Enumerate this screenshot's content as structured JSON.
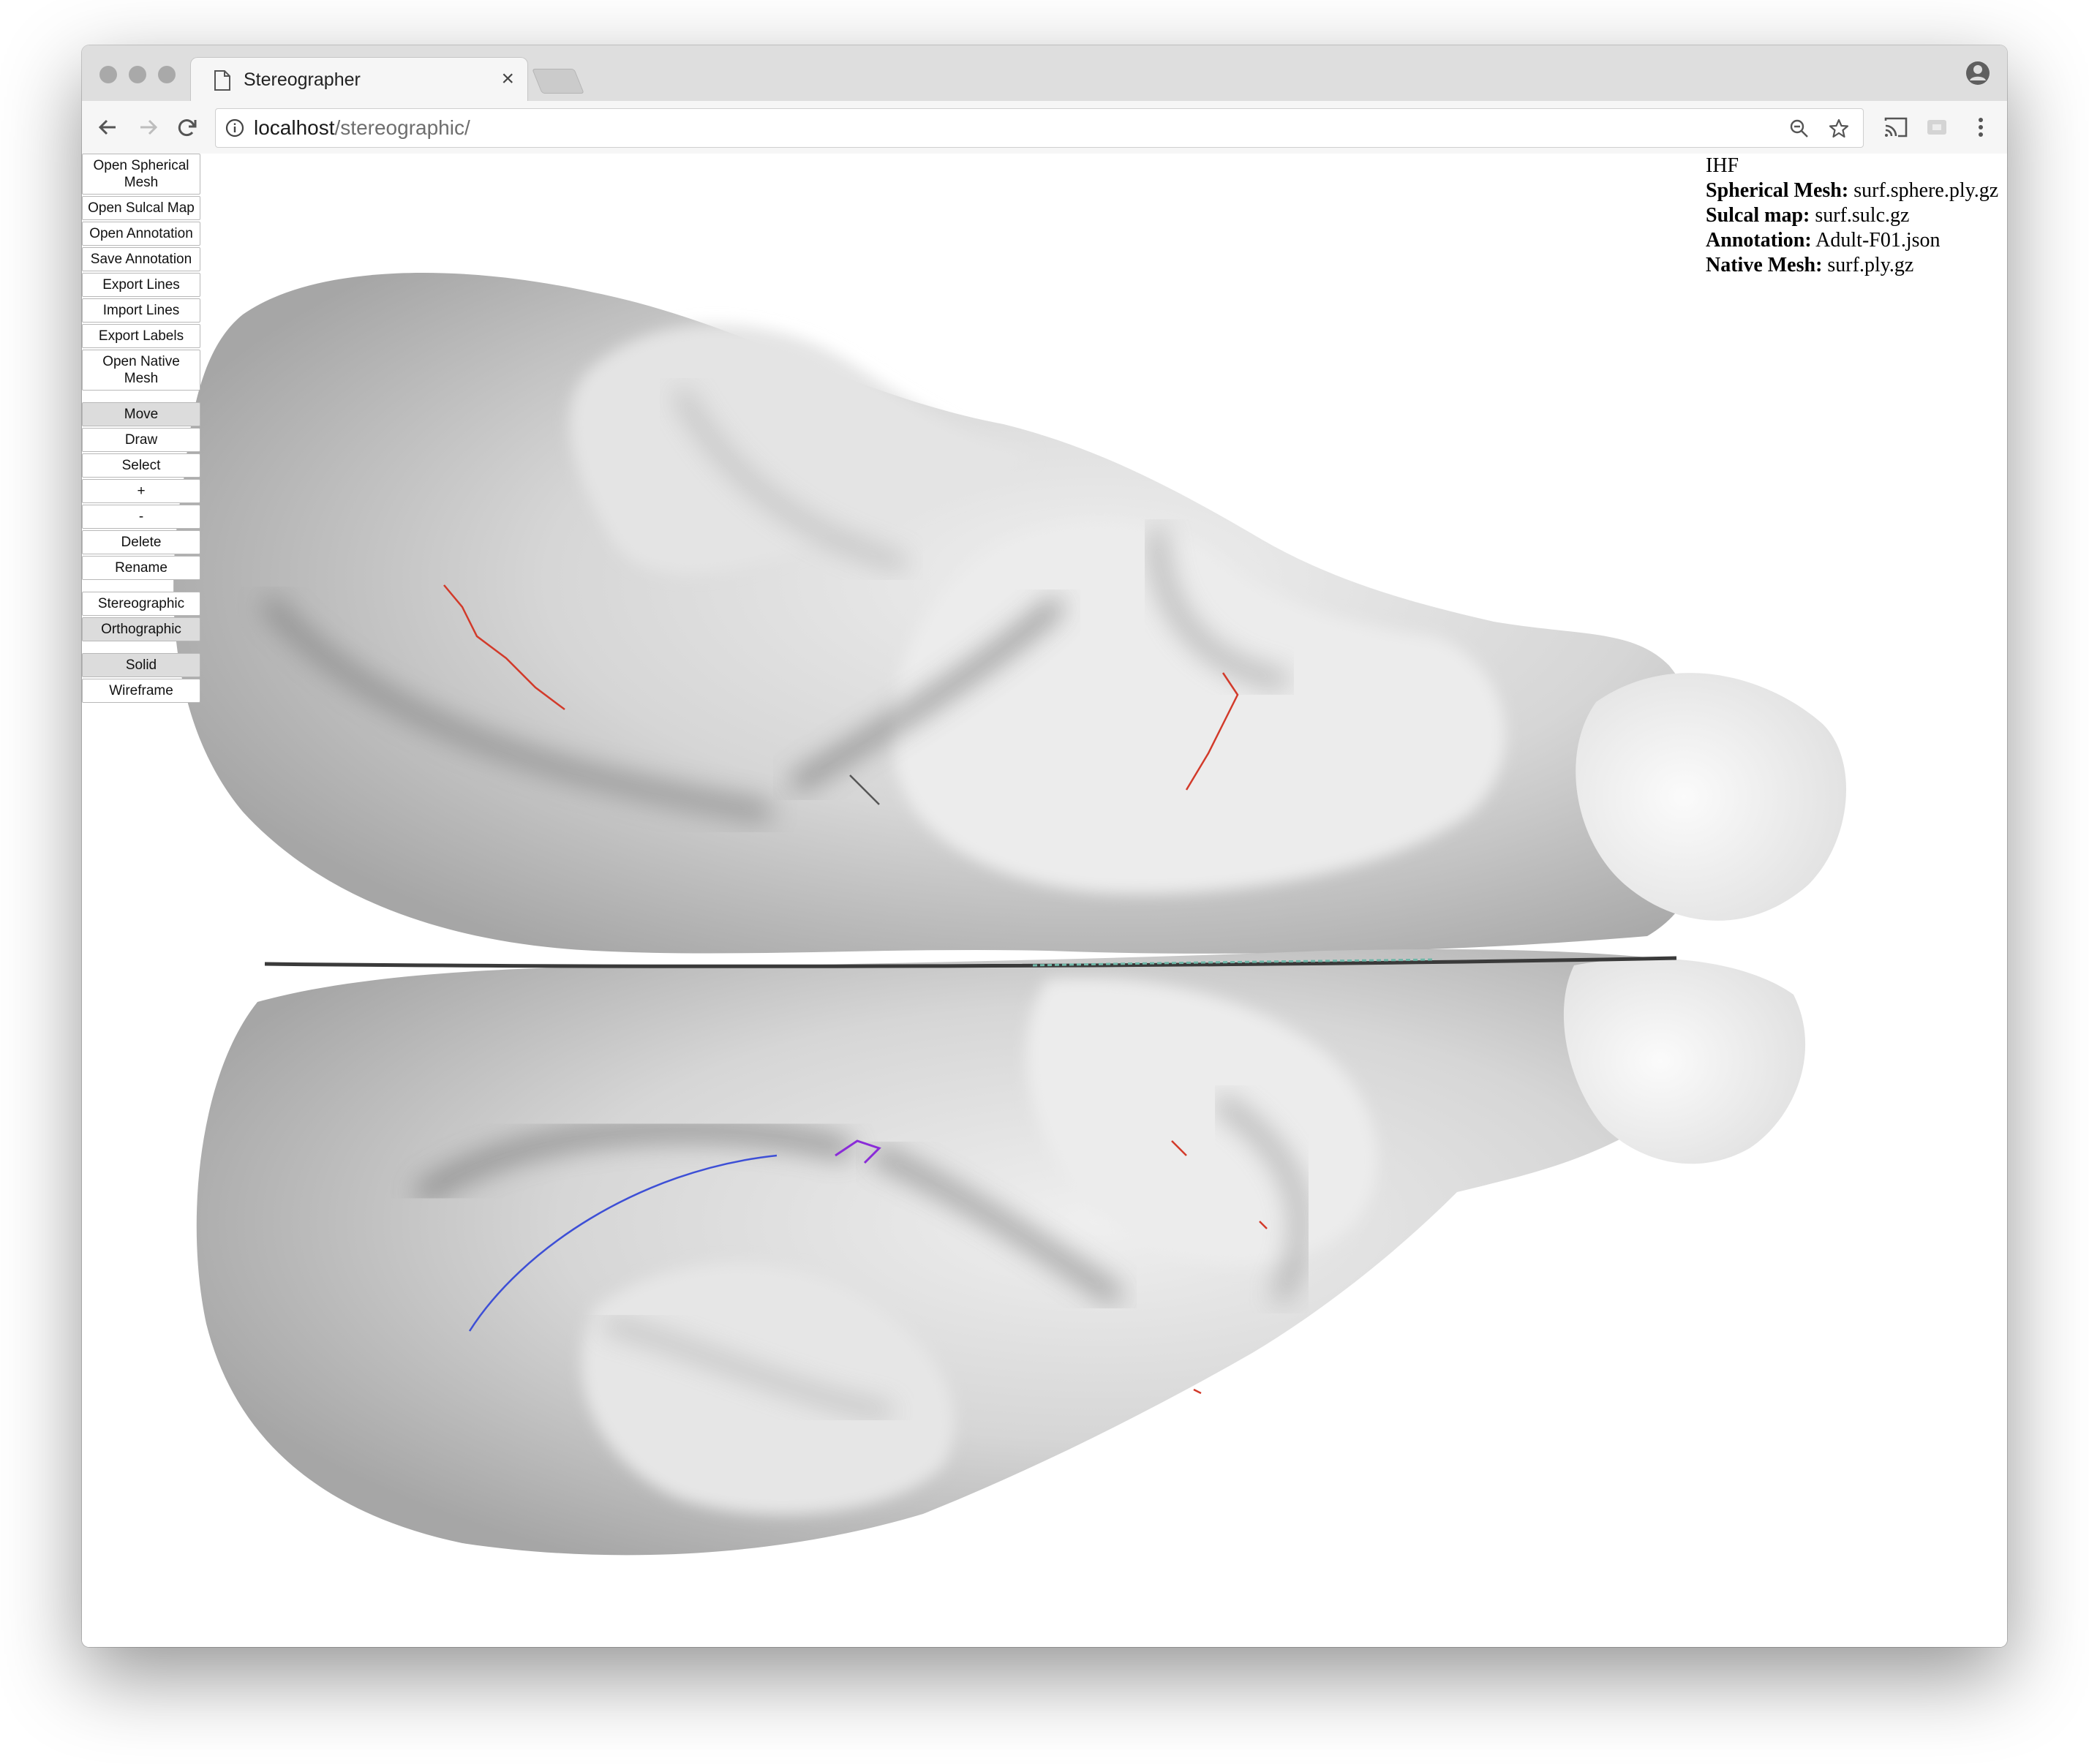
{
  "browser": {
    "tab_title": "Stereographer",
    "tab_close_glyph": "×",
    "url_host": "localhost",
    "url_path": "/stereographic/"
  },
  "controls": {
    "file_buttons": [
      "Open Spherical Mesh",
      "Open Sulcal Map",
      "Open Annotation",
      "Save Annotation",
      "Export Lines",
      "Import Lines",
      "Export Labels",
      "Open Native Mesh"
    ],
    "tool_buttons": [
      "Move",
      "Draw",
      "Select",
      "+",
      "-",
      "Delete",
      "Rename"
    ],
    "projection_buttons": [
      "Stereographic",
      "Orthographic"
    ],
    "render_buttons": [
      "Solid",
      "Wireframe"
    ],
    "active": [
      "Move",
      "Orthographic",
      "Solid"
    ]
  },
  "info": {
    "view": "IHF",
    "spherical_mesh_label": "Spherical Mesh:",
    "spherical_mesh_value": "surf.sphere.ply.gz",
    "sulcal_map_label": "Sulcal map:",
    "sulcal_map_value": "surf.sulc.gz",
    "annotation_label": "Annotation:",
    "annotation_value": "Adult-F01.json",
    "native_mesh_label": "Native Mesh:",
    "native_mesh_value": "surf.ply.gz"
  },
  "colors": {
    "surface_light": "#f2f2f2",
    "surface_dark": "#8f8f8f",
    "line_red": "#d23a2a",
    "line_blue": "#3d4fd6",
    "line_purple": "#8a2bd8",
    "line_teal": "#6fb7a8"
  }
}
